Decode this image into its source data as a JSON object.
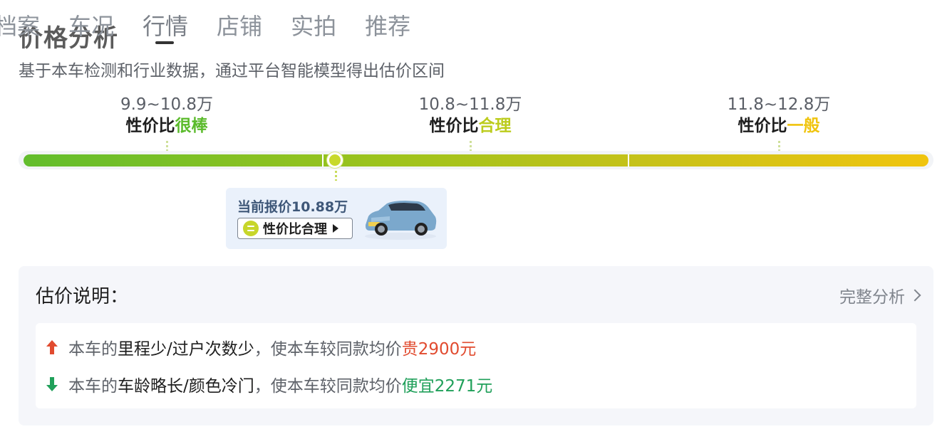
{
  "tabs": [
    "档案",
    "车况",
    "行情",
    "店铺",
    "实拍",
    "推荐"
  ],
  "active_tab": "行情",
  "section": {
    "title": "价格分析",
    "subtitle": "基于本车检测和行业数据，通过平台智能模型得出估价区间"
  },
  "ranges": [
    {
      "value": "9.9~10.8万",
      "prefix": "性价比",
      "quality": "很棒",
      "color": "#5bbb2c"
    },
    {
      "value": "10.8~11.8万",
      "prefix": "性价比",
      "quality": "合理",
      "color": "#bccc1d"
    },
    {
      "value": "11.8~12.8万",
      "prefix": "性价比",
      "quality": "一般",
      "color": "#f0c40e"
    }
  ],
  "current": {
    "price_text": "当前报价10.88万",
    "badge": "性价比合理",
    "badge_color": "#c7d62a"
  },
  "explain": {
    "title": "估价说明：",
    "link": "完整分析",
    "rows": [
      {
        "direction": "up",
        "lead": "本车的",
        "factor": "里程少/过户次数少",
        "mid": "，使本车较同款均价",
        "result": "贵2900元"
      },
      {
        "direction": "down",
        "lead": "本车的",
        "factor": "车龄略长/颜色冷门",
        "mid": "，使本车较同款均价",
        "result": "便宜2271元"
      }
    ]
  },
  "colors": {
    "up": "#e14b2f",
    "down": "#20a05a",
    "bar_start": "#62bd2d",
    "bar_end": "#f0c40e"
  },
  "icons": {
    "up_arrow": "arrow-up-icon",
    "down_arrow": "arrow-down-icon",
    "chevron": "chevron-right-icon",
    "badge": "smile-icon",
    "play": "play-icon"
  }
}
